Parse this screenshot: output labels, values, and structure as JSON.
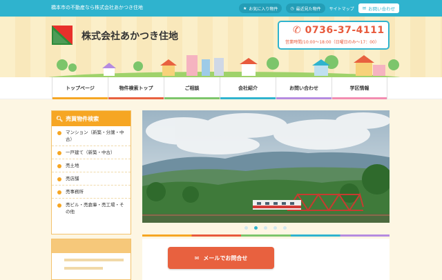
{
  "topbar": {
    "tagline": "橋本市の不動産なら株式会社あかつき住地",
    "favorites": "お気に入り物件",
    "recent": "最近見た物件",
    "sitemap": "サイトマップ",
    "contact": "お問い合わせ"
  },
  "header": {
    "company": "株式会社あかつき住地",
    "phone": "0736-37-4111",
    "hours": "営業時間/10:00～18:00（日曜日のみ～17：00）"
  },
  "nav": {
    "items": [
      {
        "label": "トップページ",
        "color": "#f6a623"
      },
      {
        "label": "物件検索トップ",
        "color": "#e8613f"
      },
      {
        "label": "ご相談",
        "color": "#7cc56b"
      },
      {
        "label": "会社紹介",
        "color": "#2fb3ce"
      },
      {
        "label": "お問い合わせ",
        "color": "#b58be0"
      },
      {
        "label": "学区情報",
        "color": "#f28db2"
      }
    ]
  },
  "sidebar": {
    "title": "売買物件検索",
    "items": [
      "マンション（新築・分譲・中古）",
      "一戸建て（新築・中古）",
      "売土地",
      "売店舗",
      "売事務所",
      "売ビル・売倉庫・売工場・その他"
    ]
  },
  "slider": {
    "slide_count": 5,
    "active_index": 1
  },
  "cta": {
    "mail_label": "メールでお問合せ"
  },
  "colors": {
    "brand": "#2fb3ce",
    "accent": "#e85a3c",
    "sidebar": "#f6a623"
  }
}
